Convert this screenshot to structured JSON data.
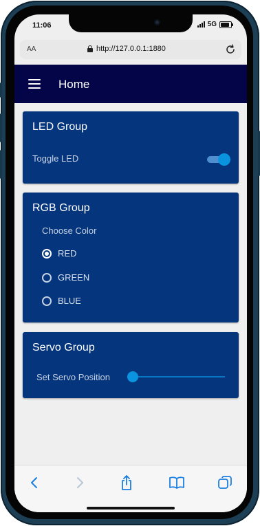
{
  "status_bar": {
    "time": "11:06",
    "network": "5G"
  },
  "browser": {
    "aa_label": "AA",
    "url": "http://127.0.0.1:1880"
  },
  "header": {
    "title": "Home"
  },
  "led_group": {
    "title": "LED Group",
    "toggle_label": "Toggle LED",
    "toggle_on": true
  },
  "rgb_group": {
    "title": "RGB Group",
    "prompt": "Choose Color",
    "options": [
      {
        "label": "RED",
        "selected": true
      },
      {
        "label": "GREEN",
        "selected": false
      },
      {
        "label": "BLUE",
        "selected": false
      }
    ]
  },
  "servo_group": {
    "title": "Servo Group",
    "slider_label": "Set Servo Position",
    "slider_fraction": 0
  },
  "colors": {
    "header_bg": "#040548",
    "card_bg": "#04357d",
    "accent": "#0a94df",
    "page_bg": "#efefef"
  },
  "icons": [
    "menu-icon",
    "lock-icon",
    "reload-icon",
    "back-icon",
    "forward-icon",
    "share-icon",
    "bookmarks-icon",
    "tabs-icon"
  ]
}
